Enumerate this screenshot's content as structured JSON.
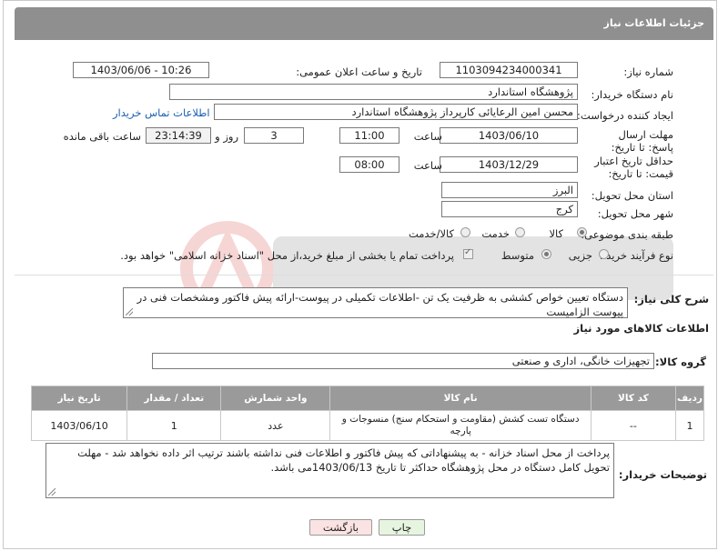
{
  "header": {
    "title": "جزئیات اطلاعات نیاز"
  },
  "form": {
    "need_number_label": "شماره نیاز:",
    "need_number": "1103094234000341",
    "announce_label": "تاریخ و ساعت اعلان عمومی:",
    "announce_value": "1403/06/06 - 10:26",
    "buyer_label": "نام دستگاه خریدار:",
    "buyer_value": "پژوهشگاه استاندارد",
    "creator_label": "ایجاد کننده درخواست:",
    "creator_value": "محسن امین الرعایائی کارپرداز پژوهشگاه استاندارد",
    "contact_link": "اطلاعات تماس خریدار",
    "deadline_label": "مهلت ارسال پاسخ: تا تاریخ:",
    "deadline_date": "1403/06/10",
    "time_label": "ساعت",
    "deadline_time": "11:00",
    "days_value": "3",
    "days_label": "روز و",
    "remaining_time": "23:14:39",
    "remaining_label": "ساعت باقی مانده",
    "validity_label": "حداقل تاریخ اعتبار قیمت: تا تاریخ:",
    "validity_date": "1403/12/29",
    "validity_time_label": "ساعت",
    "validity_time": "08:00",
    "province_label": "استان محل تحویل:",
    "province_value": "البرز",
    "city_label": "شهر محل تحویل:",
    "city_value": "کرج",
    "category_label": "طبقه بندی موضوعی:",
    "category_options": [
      "کالا",
      "خدمت",
      "کالا/خدمت"
    ],
    "process_label": "نوع فرآیند خرید :",
    "process_options": [
      "جزیی",
      "متوسط"
    ],
    "payment_note": "پرداخت تمام یا بخشی از مبلغ خرید،از محل \"اسناد خزانه اسلامی\" خواهد بود.",
    "summary_label": "شرح کلی نیاز:",
    "summary_value": "دستگاه تعیین خواص کششی به ظرفیت یک تن -اطلاعات تکمیلی در پیوست-ارائه پیش فاکتور ومشخصات فنی در پیوست الزامیست",
    "goods_section_title": "اطلاعات کالاهای مورد نیاز",
    "goods_group_label": "گروه کالا:",
    "goods_group_value": "تجهیزات خانگی، اداری و صنعتی"
  },
  "table": {
    "headers": [
      "ردیف",
      "کد کالا",
      "نام کالا",
      "واحد شمارش",
      "تعداد / مقدار",
      "تاریخ نیاز"
    ],
    "rows": [
      [
        "1",
        "--",
        "دستگاه تست کشش (مقاومت و استحکام سنج) منسوجات و پارچه",
        "عدد",
        "1",
        "1403/06/10"
      ]
    ]
  },
  "notes": {
    "label": "توضیحات خریدار:",
    "value": "پرداخت از محل اسناد خزانه - به پیشنهاداتی که پیش فاکتور و اطلاعات فنی نداشته باشند ترتیب اثر داده نخواهد شد - مهلت تحویل کامل دستگاه در محل پژوهشگاه حداکثر تا تاریخ 1403/06/13می باشد."
  },
  "buttons": {
    "print": "چاپ",
    "back": "بازگشت"
  },
  "colors": {
    "header_bg": "#8f8f8f",
    "print_btn": "#e6f5df",
    "back_btn": "#fbe3e3",
    "link": "#1a5fb4"
  }
}
